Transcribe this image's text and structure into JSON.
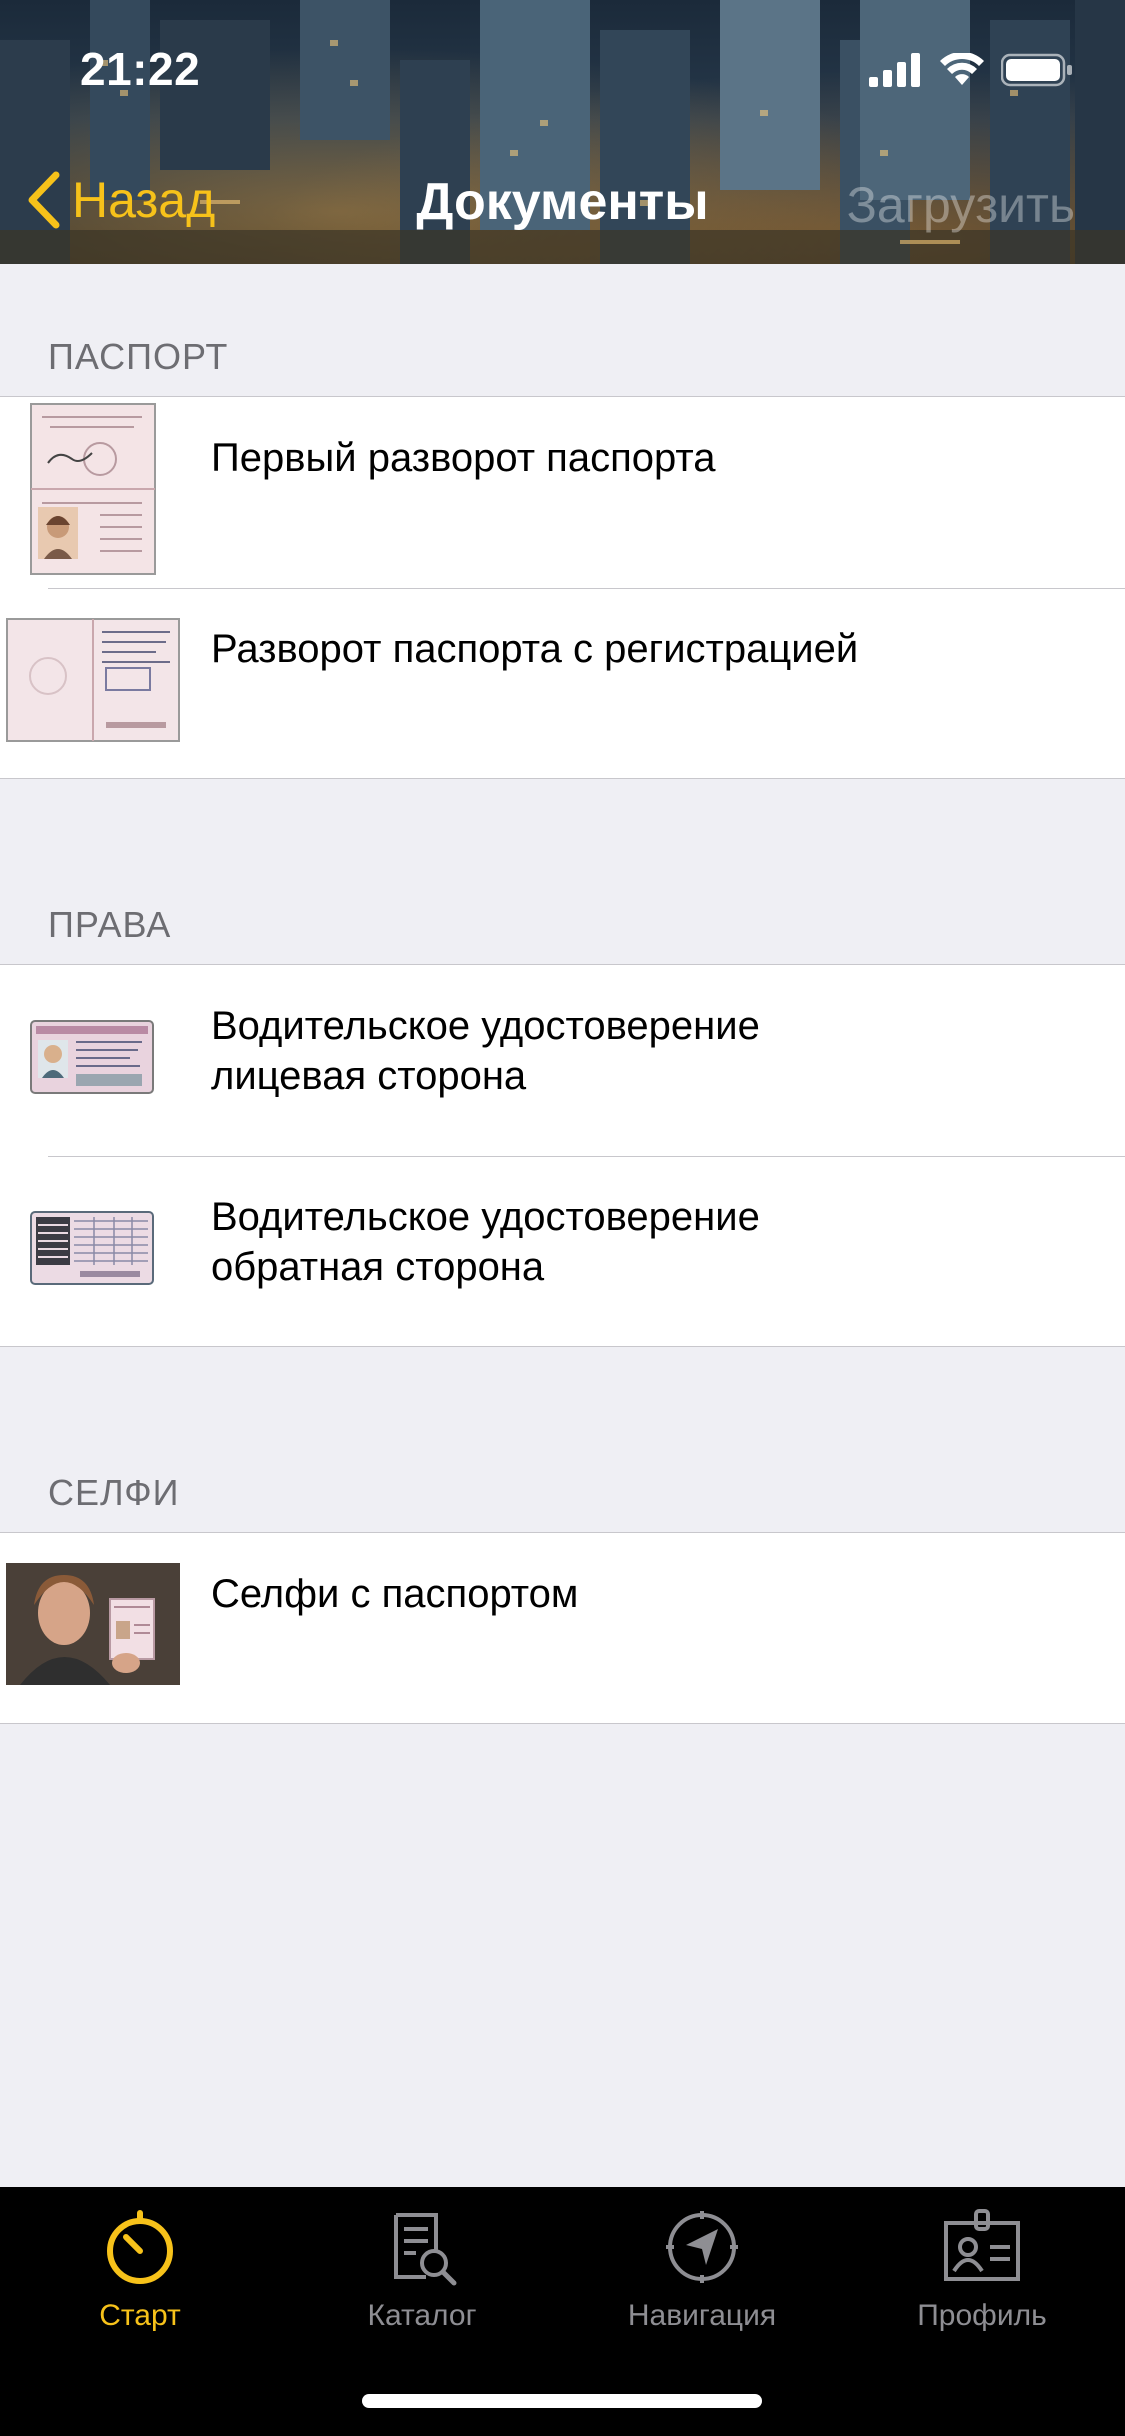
{
  "status_bar": {
    "time": "21:22"
  },
  "nav": {
    "back_label": "Назад",
    "title": "Документы",
    "action_label": "Загрузить"
  },
  "sections": [
    {
      "title": "ПАСПОРТ",
      "items": [
        {
          "label": "Первый разворот паспорта",
          "thumb": "passport-main-page"
        },
        {
          "label": "Разворот паспорта с регистрацией",
          "thumb": "passport-registration-page"
        }
      ]
    },
    {
      "title": "ПРАВА",
      "items": [
        {
          "label_line1": "Водительское удостоверение",
          "label_line2": "лицевая сторона",
          "thumb": "license-front"
        },
        {
          "label_line1": "Водительское удостоверение",
          "label_line2": "обратная сторона",
          "thumb": "license-back"
        }
      ]
    },
    {
      "title": "СЕЛФИ",
      "items": [
        {
          "label": "Селфи с паспортом",
          "thumb": "selfie-with-passport"
        }
      ]
    }
  ],
  "tab_bar": {
    "items": [
      {
        "label": "Старт",
        "icon": "stopwatch-icon",
        "active": true
      },
      {
        "label": "Каталог",
        "icon": "catalog-search-icon",
        "active": false
      },
      {
        "label": "Навигация",
        "icon": "compass-icon",
        "active": false
      },
      {
        "label": "Профиль",
        "icon": "id-card-icon",
        "active": false
      }
    ]
  },
  "colors": {
    "accent": "#f7c21a",
    "background": "#efeff4",
    "separator": "#c8c7cc",
    "section_text": "#6d6d72",
    "tab_inactive": "#8e8e93"
  }
}
